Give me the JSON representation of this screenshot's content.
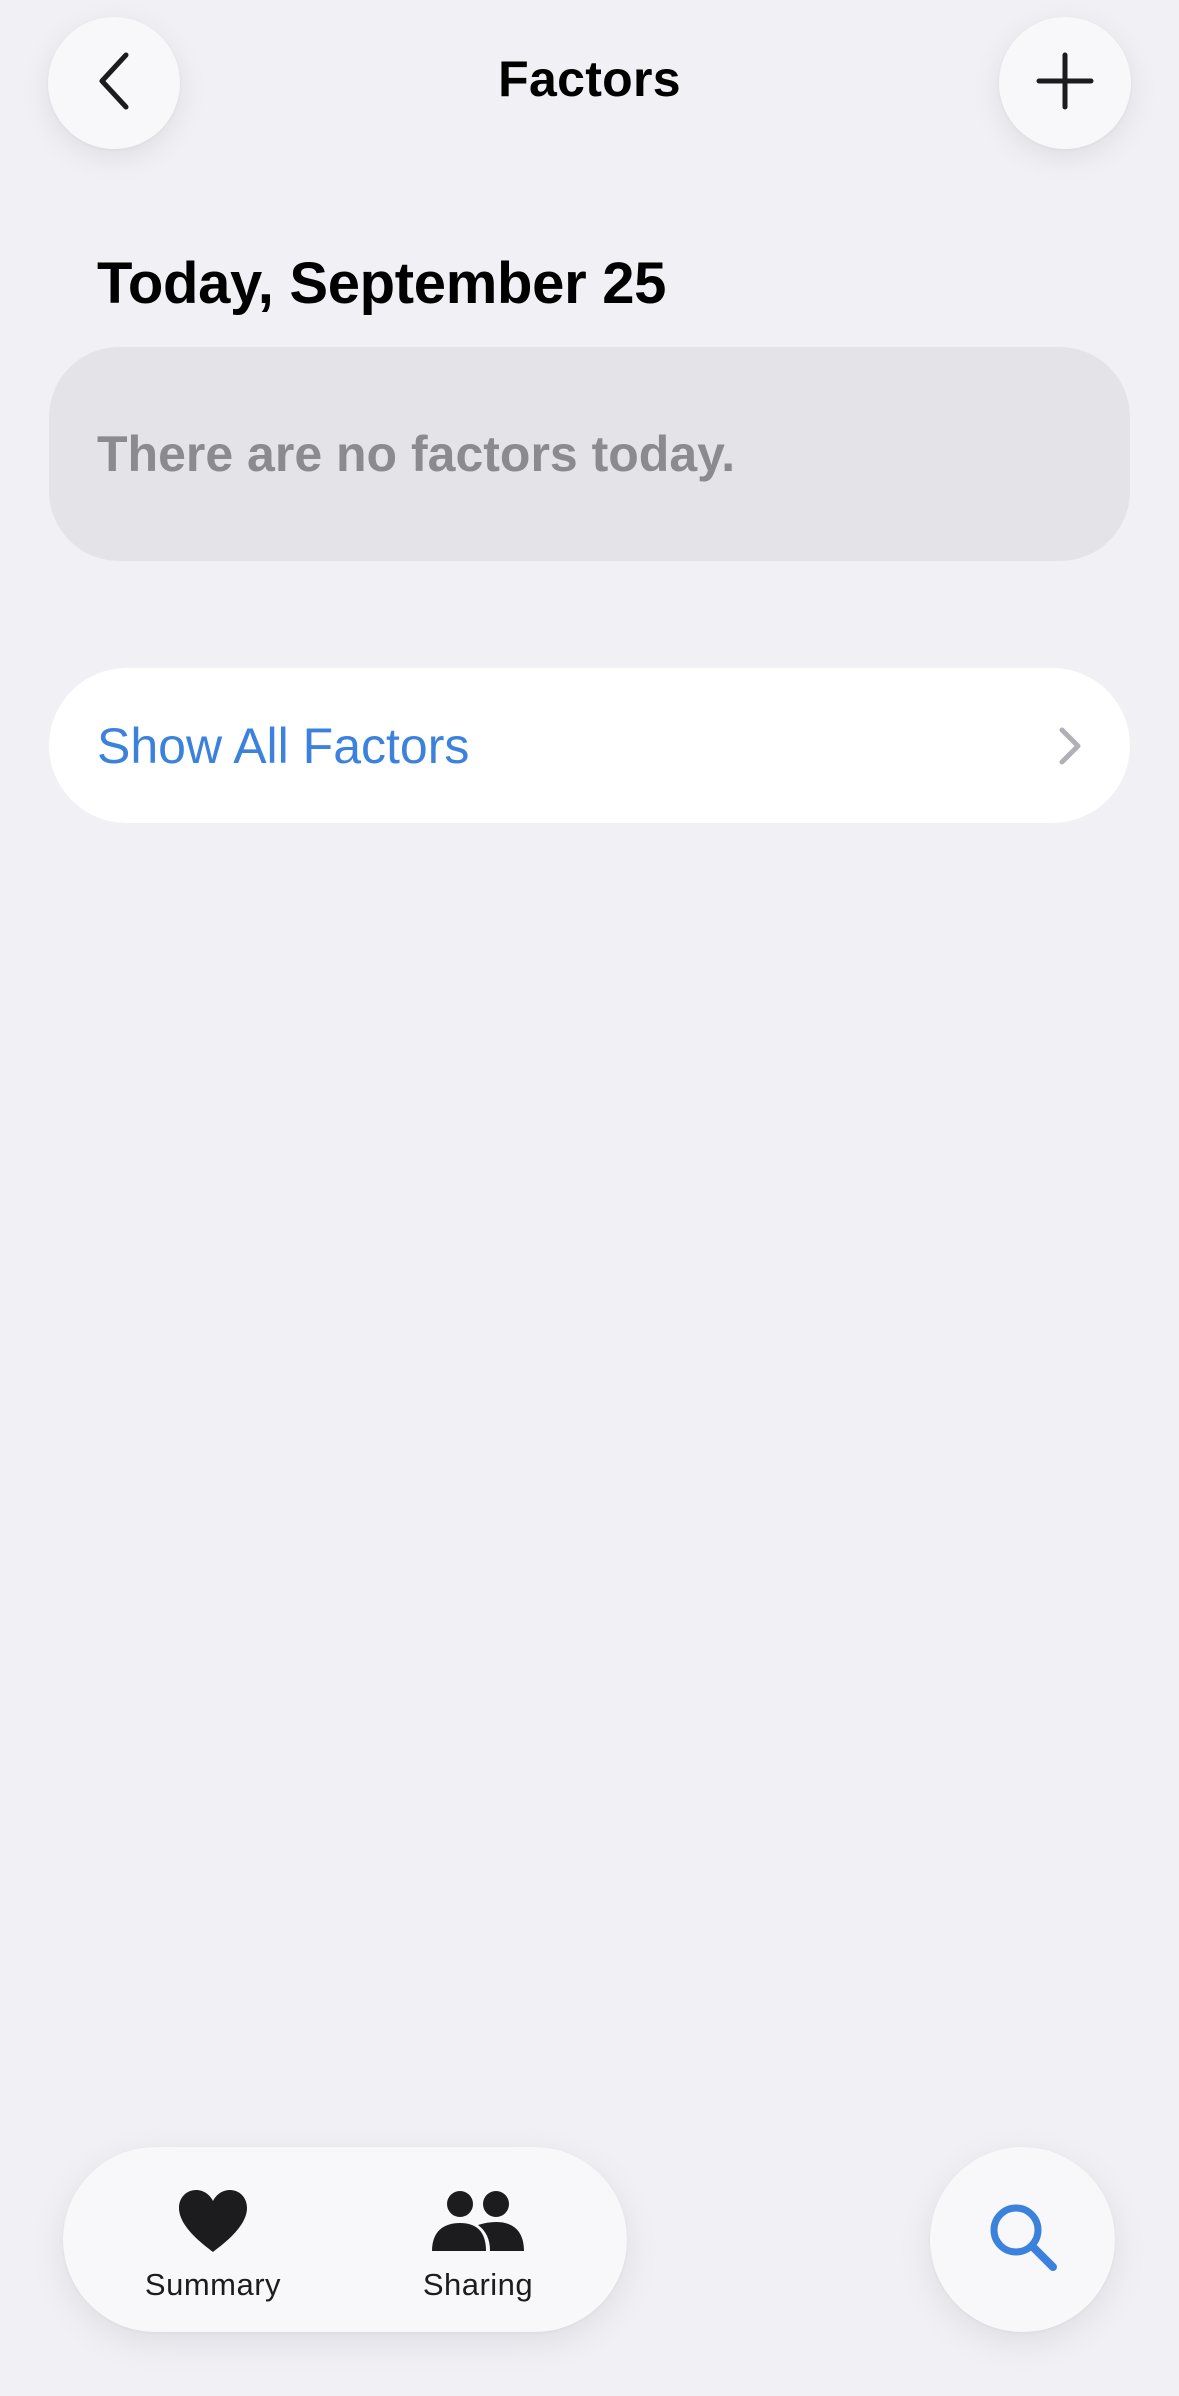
{
  "nav": {
    "title": "Factors",
    "back_icon": "chevron-left-icon",
    "add_icon": "plus-icon"
  },
  "today": {
    "heading": "Today, September 25",
    "empty_message": "There are no factors today."
  },
  "show_all": {
    "label": "Show All Factors",
    "icon": "chevron-right-icon"
  },
  "tab_bar": {
    "items": [
      {
        "label": "Summary",
        "icon": "heart-icon"
      },
      {
        "label": "Sharing",
        "icon": "people-icon"
      }
    ],
    "search_icon": "search-icon"
  },
  "colors": {
    "background": "#f0f0f5",
    "accent": "#3c82dc",
    "secondary_text": "#8a8a8f",
    "empty_card": "#e3e3e8"
  }
}
